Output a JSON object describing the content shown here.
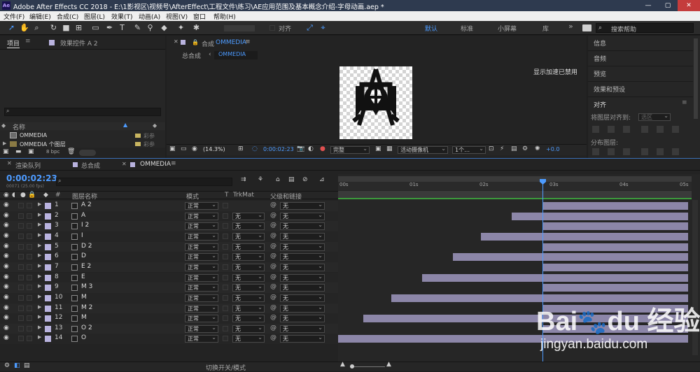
{
  "window": {
    "app_icon": "Ae",
    "title": "Adobe After Effects CC 2018 - E:\\1影视区\\视频号\\AfterEffect\\工程文件\\练习\\AE应用范围及基本概念介绍-字母动画.aep *",
    "min": "—",
    "max": "▢",
    "close": "✕"
  },
  "menu": [
    "文件(F)",
    "编辑(E)",
    "合成(C)",
    "图层(L)",
    "效果(T)",
    "动画(A)",
    "视图(V)",
    "窗口",
    "帮助(H)"
  ],
  "toolbar": {
    "align_label": "对齐",
    "workspaces": [
      "默认",
      "标准",
      "小屏幕",
      "库"
    ],
    "more": "»",
    "search_placeholder": "搜索帮助"
  },
  "project_panel": {
    "tab_project": "项目",
    "tab_effects": "效果控件 A 2",
    "col_name": "名称",
    "items": [
      {
        "name": "OMMEDIA",
        "type": "彩参"
      },
      {
        "name": "OMMEDIA 个图层",
        "type": "彩参"
      }
    ],
    "bpc": "8 bpc"
  },
  "comp_panel": {
    "tab": "合成",
    "comp_name": "OMMEDIA",
    "breadcrumb": "总合成",
    "flowchart_chip": "OMMEDIA",
    "accel_notice": "显示加速已禁用",
    "zoom": "(14.3%)",
    "timecode": "0:00:02:23",
    "resolution": "完整",
    "camera": "活动摄像机",
    "views": "1个…",
    "exposure": "+0.0"
  },
  "right_panel": {
    "items": [
      "信息",
      "音频",
      "预览",
      "效果和预设"
    ],
    "align_title": "对齐",
    "align_to_label": "将图层对齐到:",
    "align_to_value": "选区",
    "distribute_label": "分布图层:"
  },
  "timeline": {
    "tabs": [
      "渲染队列",
      "总合成",
      "OMMEDIA"
    ],
    "timecode": "0:00:02:23",
    "frame_info": "00071 (25.00 fps)",
    "col_layer": "图层名称",
    "col_mode": "模式",
    "col_t": "T",
    "col_trkmat": "TrkMat",
    "col_parent": "父级和链接",
    "ruler": [
      "00s",
      "01s",
      "02s",
      "03s",
      "04s",
      "05s"
    ],
    "current_time_s": 2.92,
    "duration_s": 5,
    "layers": [
      {
        "num": "1",
        "name": "A 2",
        "mode": "正常",
        "trkmat": "",
        "parent": "无",
        "in_s": 2.92
      },
      {
        "num": "2",
        "name": "A",
        "mode": "正常",
        "trkmat": "无",
        "parent": "无",
        "in_s": 2.48
      },
      {
        "num": "3",
        "name": "I 2",
        "mode": "正常",
        "trkmat": "无",
        "parent": "无",
        "in_s": 2.92
      },
      {
        "num": "4",
        "name": "I",
        "mode": "正常",
        "trkmat": "无",
        "parent": "无",
        "in_s": 2.04
      },
      {
        "num": "5",
        "name": "D 2",
        "mode": "正常",
        "trkmat": "无",
        "parent": "无",
        "in_s": 2.92
      },
      {
        "num": "6",
        "name": "D",
        "mode": "正常",
        "trkmat": "无",
        "parent": "无",
        "in_s": 1.64
      },
      {
        "num": "7",
        "name": "E 2",
        "mode": "正常",
        "trkmat": "无",
        "parent": "无",
        "in_s": 2.92
      },
      {
        "num": "8",
        "name": "E",
        "mode": "正常",
        "trkmat": "无",
        "parent": "无",
        "in_s": 1.2
      },
      {
        "num": "9",
        "name": "M 3",
        "mode": "正常",
        "trkmat": "无",
        "parent": "无",
        "in_s": 2.92
      },
      {
        "num": "10",
        "name": "M",
        "mode": "正常",
        "trkmat": "无",
        "parent": "无",
        "in_s": 0.76
      },
      {
        "num": "11",
        "name": "M 2",
        "mode": "正常",
        "trkmat": "无",
        "parent": "无",
        "in_s": 2.92
      },
      {
        "num": "12",
        "name": "M",
        "mode": "正常",
        "trkmat": "无",
        "parent": "无",
        "in_s": 0.36
      },
      {
        "num": "13",
        "name": "O 2",
        "mode": "正常",
        "trkmat": "无",
        "parent": "无",
        "in_s": 2.92
      },
      {
        "num": "14",
        "name": "O",
        "mode": "正常",
        "trkmat": "无",
        "parent": "无",
        "in_s": 0
      }
    ],
    "footer_toggle": "切换开关/模式"
  },
  "watermark": {
    "logo": "Bai du 经验",
    "url": "jingyan.baidu.com"
  }
}
